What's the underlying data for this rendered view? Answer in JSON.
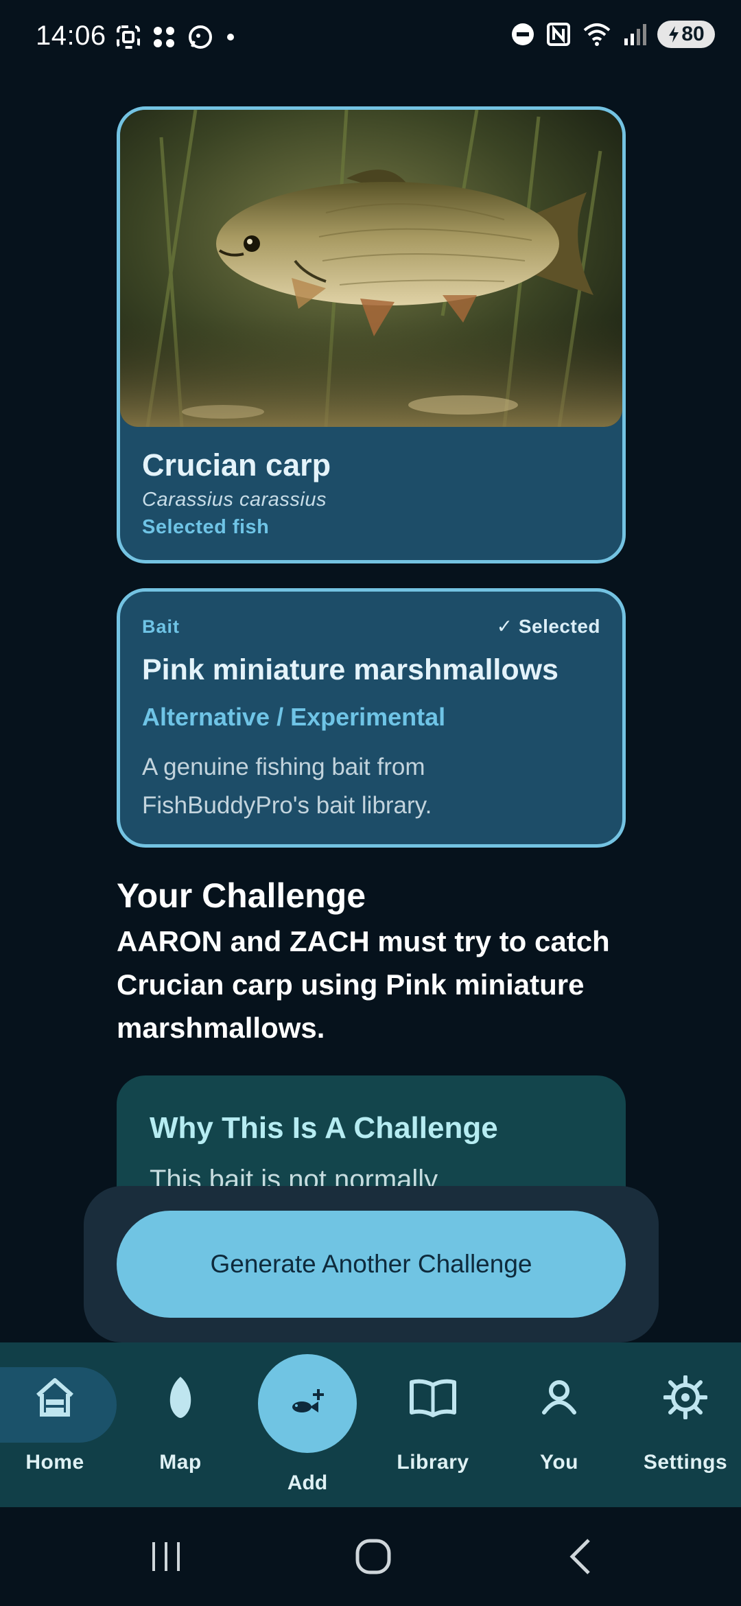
{
  "status_bar": {
    "time": "14:06",
    "battery": "80"
  },
  "fish": {
    "name": "Crucian carp",
    "latin_name": "Carassius carassius",
    "status": "Selected fish"
  },
  "bait": {
    "section_label": "Bait",
    "selected_label": "✓ Selected",
    "name": "Pink miniature marshmallows",
    "category": "Alternative / Experimental",
    "description": "A genuine fishing bait from FishBuddyPro's bait library."
  },
  "challenge": {
    "heading": "Your Challenge",
    "text": "AARON and ZACH must try to catch Crucian carp using Pink miniature marshmallows.",
    "why_title": "Why This Is A Challenge",
    "why_text": "This bait is not normally",
    "generate_button": "Generate Another Challenge"
  },
  "nav": {
    "home": "Home",
    "map": "Map",
    "add": "Add",
    "library": "Library",
    "you": "You",
    "settings": "Settings"
  },
  "colors": {
    "background": "#06121c",
    "card": "#1d4d68",
    "accent": "#70c4e3",
    "nav_bar": "#113f48"
  }
}
